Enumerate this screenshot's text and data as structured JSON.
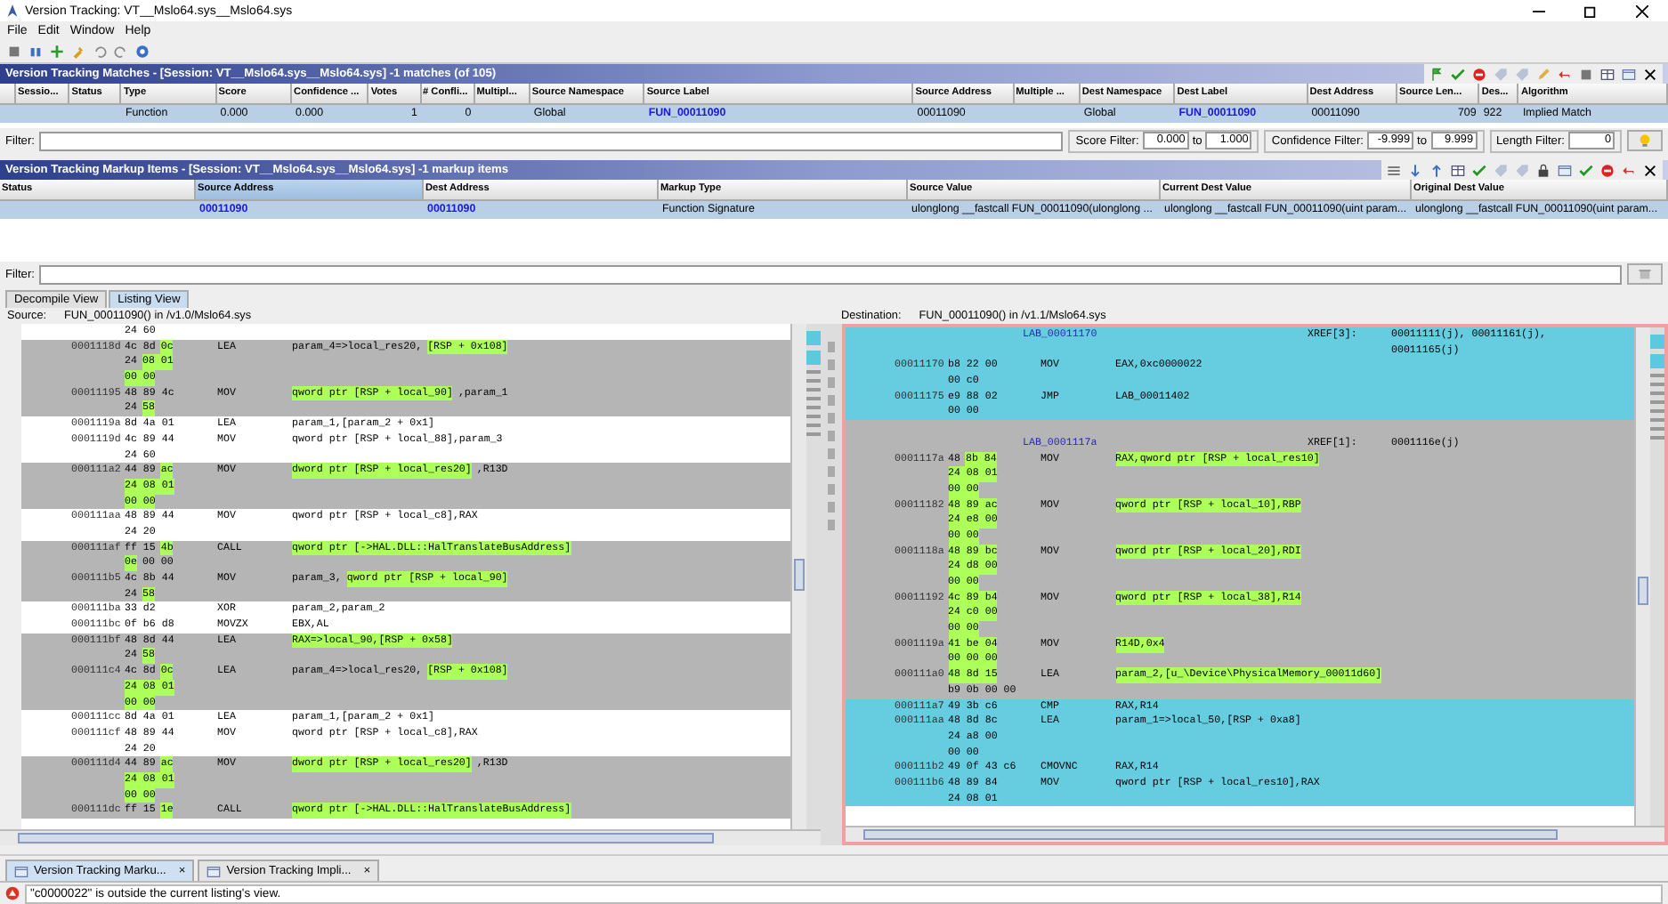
{
  "window": {
    "title": "Version Tracking: VT__Mslo64.sys__Mslo64.sys"
  },
  "menu": [
    "File",
    "Edit",
    "Window",
    "Help"
  ],
  "matches": {
    "title": "Version Tracking Matches - [Session: VT__Mslo64.sys__Mslo64.sys] -1 matches (of 105)",
    "columns": [
      {
        "label": "Sessio...",
        "kind": "text"
      },
      {
        "label": "Status",
        "kind": "text"
      },
      {
        "label": "Type",
        "kind": "text"
      },
      {
        "label": "Score",
        "kind": "text"
      },
      {
        "label": "Confidence ...",
        "kind": "text"
      },
      {
        "label": "Votes",
        "kind": "number"
      },
      {
        "label": "# Confli...",
        "kind": "number"
      },
      {
        "label": "Multipl...",
        "kind": "text"
      },
      {
        "label": "Source Namespace",
        "kind": "text"
      },
      {
        "label": "Source Label",
        "kind": "link"
      },
      {
        "label": "Source Address",
        "kind": "text"
      },
      {
        "label": "Multiple ...",
        "kind": "text"
      },
      {
        "label": "Dest Namespace",
        "kind": "text"
      },
      {
        "label": "Dest Label",
        "kind": "link"
      },
      {
        "label": "Dest Address",
        "kind": "text"
      },
      {
        "label": "Source Len...",
        "kind": "number"
      },
      {
        "label": "Des...",
        "kind": "text"
      },
      {
        "label": "Algorithm",
        "kind": "text"
      }
    ],
    "rows": [
      {
        "selected": true,
        "cells": [
          "",
          "",
          "Function",
          "0.000",
          "0.000",
          "1",
          "0",
          "",
          "Global",
          "FUN_00011090",
          "00011090",
          "",
          "Global",
          "FUN_00011090",
          "00011090",
          "709",
          "922",
          "Implied Match"
        ]
      }
    ],
    "filter_label": "Filter:",
    "score_filter": {
      "label": "Score Filter:",
      "from": "0.000",
      "to_label": "to",
      "to": "1.000"
    },
    "confidence_filter": {
      "label": "Confidence Filter:",
      "from": "-9.999",
      "to_label": "to",
      "to": "9.999"
    },
    "length_filter": {
      "label": "Length Filter:",
      "value": "0"
    }
  },
  "markup": {
    "title": "Version Tracking Markup Items - [Session: VT__Mslo64.sys__Mslo64.sys] -1 markup items",
    "columns": [
      {
        "label": "Status",
        "kind": "text",
        "sorted": false
      },
      {
        "label": "Source Address",
        "kind": "link",
        "sorted": true
      },
      {
        "label": "Dest Address",
        "kind": "link",
        "sorted": false
      },
      {
        "label": "Markup Type",
        "kind": "text",
        "sorted": false
      },
      {
        "label": "Source Value",
        "kind": "text",
        "sorted": false
      },
      {
        "label": "Current Dest Value",
        "kind": "text",
        "sorted": false
      },
      {
        "label": "Original Dest Value",
        "kind": "text",
        "sorted": false
      }
    ],
    "rows": [
      {
        "selected": true,
        "cells": [
          "",
          "00011090",
          "00011090",
          "Function Signature",
          "ulonglong __fastcall FUN_00011090(ulonglong ...",
          "ulonglong __fastcall FUN_00011090(uint param...",
          "ulonglong __fastcall FUN_00011090(uint param..."
        ]
      }
    ],
    "filter_label": "Filter:"
  },
  "view_tabs": [
    {
      "label": "Decompile View",
      "selected": false
    },
    {
      "label": "Listing View",
      "selected": true
    }
  ],
  "source": {
    "label": "Source:",
    "function": "FUN_00011090() in /v1.0/Mslo64.sys",
    "blocks": [
      {
        "kind": "plain",
        "lines": [
          {
            "kind": "more",
            "bytes": [
              {
                "text": "24 60",
                "marked": false
              }
            ]
          }
        ]
      },
      {
        "kind": "markup",
        "lines": [
          {
            "kind": "code",
            "address": "0001118d",
            "bytes": [
              {
                "text": "4c 8d",
                "marked": false
              },
              {
                "text": "0c",
                "marked": true
              }
            ],
            "mnemonic": "LEA",
            "operand": [
              {
                "text": "param_4=>local_res20,",
                "marked": false
              },
              {
                "text": "[RSP + 0x108]",
                "marked": true
              }
            ]
          },
          {
            "kind": "more",
            "bytes": [
              {
                "text": "24",
                "marked": false
              },
              {
                "text": "08 01",
                "marked": true
              }
            ]
          },
          {
            "kind": "more",
            "bytes": [
              {
                "text": "00 00",
                "marked": true
              }
            ]
          },
          {
            "kind": "code",
            "address": "00011195",
            "bytes": [
              {
                "text": "48 89 4c",
                "marked": false
              }
            ],
            "mnemonic": "MOV",
            "operand": [
              {
                "text": "qword ptr [RSP + local_90]",
                "marked": true
              },
              {
                "text": ",param_1",
                "marked": false
              }
            ]
          },
          {
            "kind": "more",
            "bytes": [
              {
                "text": "24",
                "marked": false
              },
              {
                "text": "58",
                "marked": true
              }
            ]
          }
        ]
      },
      {
        "kind": "plain",
        "lines": [
          {
            "kind": "code",
            "address": "0001119a",
            "bytes": [
              {
                "text": "8d 4a 01",
                "marked": false
              }
            ],
            "mnemonic": "LEA",
            "operand": [
              {
                "text": "param_1,[param_2 + 0x1]",
                "marked": false
              }
            ]
          },
          {
            "kind": "code",
            "address": "0001119d",
            "bytes": [
              {
                "text": "4c 89 44",
                "marked": false
              }
            ],
            "mnemonic": "MOV",
            "operand": [
              {
                "text": "qword ptr [RSP + local_88],param_3",
                "marked": false
              }
            ]
          },
          {
            "kind": "more",
            "bytes": [
              {
                "text": "24 60",
                "marked": false
              }
            ]
          }
        ]
      },
      {
        "kind": "markup",
        "lines": [
          {
            "kind": "code",
            "address": "000111a2",
            "bytes": [
              {
                "text": "44 89",
                "marked": false
              },
              {
                "text": "ac",
                "marked": true
              }
            ],
            "mnemonic": "MOV",
            "operand": [
              {
                "text": "dword ptr [RSP + local_res20]",
                "marked": true
              },
              {
                "text": ",R13D",
                "marked": false
              }
            ]
          },
          {
            "kind": "more",
            "bytes": [
              {
                "text": "24 08 01",
                "marked": true
              }
            ]
          },
          {
            "kind": "more",
            "bytes": [
              {
                "text": "00 00",
                "marked": true
              }
            ]
          }
        ]
      },
      {
        "kind": "plain",
        "lines": [
          {
            "kind": "code",
            "address": "000111aa",
            "bytes": [
              {
                "text": "48 89 44",
                "marked": false
              }
            ],
            "mnemonic": "MOV",
            "operand": [
              {
                "text": "qword ptr [RSP + local_c8],RAX",
                "marked": false
              }
            ]
          },
          {
            "kind": "more",
            "bytes": [
              {
                "text": "24 20",
                "marked": false
              }
            ]
          }
        ]
      },
      {
        "kind": "markup",
        "lines": [
          {
            "kind": "code",
            "address": "000111af",
            "bytes": [
              {
                "text": "ff 15",
                "marked": false
              },
              {
                "text": "4b",
                "marked": true
              }
            ],
            "mnemonic": "CALL",
            "operand": [
              {
                "text": "qword ptr [->HAL.DLL::HalTranslateBusAddress]",
                "marked": true
              }
            ]
          },
          {
            "kind": "more",
            "bytes": [
              {
                "text": "0e",
                "marked": true
              },
              {
                "text": "00 00",
                "marked": false
              }
            ]
          },
          {
            "kind": "code",
            "address": "000111b5",
            "bytes": [
              {
                "text": "4c 8b 44",
                "marked": false
              }
            ],
            "mnemonic": "MOV",
            "operand": [
              {
                "text": "param_3,",
                "marked": false
              },
              {
                "text": "qword ptr [RSP + local_90]",
                "marked": true
              }
            ]
          },
          {
            "kind": "more",
            "bytes": [
              {
                "text": "24",
                "marked": false
              },
              {
                "text": "58",
                "marked": true
              }
            ]
          }
        ]
      },
      {
        "kind": "plain",
        "lines": [
          {
            "kind": "code",
            "address": "000111ba",
            "bytes": [
              {
                "text": "33 d2",
                "marked": false
              }
            ],
            "mnemonic": "XOR",
            "operand": [
              {
                "text": "param_2,param_2",
                "marked": false
              }
            ]
          },
          {
            "kind": "code",
            "address": "000111bc",
            "bytes": [
              {
                "text": "0f b6 d8",
                "marked": false
              }
            ],
            "mnemonic": "MOVZX",
            "operand": [
              {
                "text": "EBX,AL",
                "marked": false
              }
            ]
          }
        ]
      },
      {
        "kind": "markup",
        "lines": [
          {
            "kind": "code",
            "address": "000111bf",
            "bytes": [
              {
                "text": "48 8d 44",
                "marked": false
              }
            ],
            "mnemonic": "LEA",
            "operand": [
              {
                "text": "RAX=>local_90,[RSP + 0x58]",
                "marked": true
              }
            ]
          },
          {
            "kind": "more",
            "bytes": [
              {
                "text": "24",
                "marked": false
              },
              {
                "text": "58",
                "marked": true
              }
            ]
          },
          {
            "kind": "code",
            "address": "000111c4",
            "bytes": [
              {
                "text": "4c 8d",
                "marked": false
              },
              {
                "text": "0c",
                "marked": true
              }
            ],
            "mnemonic": "LEA",
            "operand": [
              {
                "text": "param_4=>local_res20,",
                "marked": false
              },
              {
                "text": "[RSP + 0x108]",
                "marked": true
              }
            ]
          },
          {
            "kind": "more",
            "bytes": [
              {
                "text": "24 08 01",
                "marked": true
              }
            ]
          },
          {
            "kind": "more",
            "bytes": [
              {
                "text": "00 00",
                "marked": true
              }
            ]
          }
        ]
      },
      {
        "kind": "plain",
        "lines": [
          {
            "kind": "code",
            "address": "000111cc",
            "bytes": [
              {
                "text": "8d 4a 01",
                "marked": false
              }
            ],
            "mnemonic": "LEA",
            "operand": [
              {
                "text": "param_1,[param_2 + 0x1]",
                "marked": false
              }
            ]
          },
          {
            "kind": "code",
            "address": "000111cf",
            "bytes": [
              {
                "text": "48 89 44",
                "marked": false
              }
            ],
            "mnemonic": "MOV",
            "operand": [
              {
                "text": "qword ptr [RSP + local_c8],RAX",
                "marked": false
              }
            ]
          },
          {
            "kind": "more",
            "bytes": [
              {
                "text": "24 20",
                "marked": false
              }
            ]
          }
        ]
      },
      {
        "kind": "markup",
        "lines": [
          {
            "kind": "code",
            "address": "000111d4",
            "bytes": [
              {
                "text": "44 89",
                "marked": false
              },
              {
                "text": "ac",
                "marked": true
              }
            ],
            "mnemonic": "MOV",
            "operand": [
              {
                "text": "dword ptr [RSP + local_res20]",
                "marked": true
              },
              {
                "text": ",R13D",
                "marked": false
              }
            ]
          },
          {
            "kind": "more",
            "bytes": [
              {
                "text": "24 08 01",
                "marked": true
              }
            ]
          },
          {
            "kind": "more",
            "bytes": [
              {
                "text": "00 00",
                "marked": true
              }
            ]
          },
          {
            "kind": "code",
            "address": "000111dc",
            "bytes": [
              {
                "text": "ff 15",
                "marked": false
              },
              {
                "text": "1e",
                "marked": true
              }
            ],
            "mnemonic": "CALL",
            "operand": [
              {
                "text": "qword ptr [->HAL.DLL::HalTranslateBusAddress]",
                "marked": true
              }
            ]
          }
        ]
      }
    ]
  },
  "destination": {
    "label": "Destination:",
    "function": "FUN_00011090() in /v1.1/Mslo64.sys",
    "blocks": [
      {
        "kind": "cursor",
        "lines": [
          {
            "kind": "label",
            "label": "LAB_00011170",
            "xref_title": "XREF[3]:",
            "xrefs": [
              "00011111(j), 00011161(j),",
              "00011165(j)"
            ]
          },
          {
            "kind": "code",
            "address": "00011170",
            "bytes": [
              {
                "text": "b8 22 00",
                "marked": false
              }
            ],
            "mnemonic": "MOV",
            "operand": [
              {
                "text": "EAX,0xc0000022",
                "marked": false
              }
            ]
          },
          {
            "kind": "more",
            "bytes": [
              {
                "text": "00 c0",
                "marked": false
              }
            ]
          },
          {
            "kind": "code",
            "address": "00011175",
            "bytes": [
              {
                "text": "e9 88 02",
                "marked": false
              }
            ],
            "mnemonic": "JMP",
            "operand": [
              {
                "text": "LAB_00011402",
                "marked": false
              }
            ]
          },
          {
            "kind": "more",
            "bytes": [
              {
                "text": "00 00",
                "marked": false
              }
            ]
          }
        ]
      },
      {
        "kind": "markup",
        "lines": [
          {
            "kind": "label",
            "label": "LAB_0001117a",
            "xref_title": "XREF[1]:",
            "xrefs": [
              "0001116e(j)"
            ]
          },
          {
            "kind": "code",
            "address": "0001117a",
            "bytes": [
              {
                "text": "48",
                "marked": false
              },
              {
                "text": "8b 84",
                "marked": true
              }
            ],
            "mnemonic": "MOV",
            "operand": [
              {
                "text": "RAX,qword ptr [RSP + local_res10]",
                "marked": true
              }
            ]
          },
          {
            "kind": "more",
            "bytes": [
              {
                "text": "24 08 01",
                "marked": true
              }
            ]
          },
          {
            "kind": "more",
            "bytes": [
              {
                "text": "00 00",
                "marked": true
              }
            ]
          },
          {
            "kind": "code",
            "address": "00011182",
            "bytes": [
              {
                "text": "48 89 ac",
                "marked": true
              }
            ],
            "mnemonic": "MOV",
            "operand": [
              {
                "text": "qword ptr [RSP + local_10],RBP",
                "marked": true
              }
            ]
          },
          {
            "kind": "more",
            "bytes": [
              {
                "text": "24 e8 00",
                "marked": true
              }
            ]
          },
          {
            "kind": "more",
            "bytes": [
              {
                "text": "00 00",
                "marked": true
              }
            ]
          },
          {
            "kind": "code",
            "address": "0001118a",
            "bytes": [
              {
                "text": "48 89 bc",
                "marked": true
              }
            ],
            "mnemonic": "MOV",
            "operand": [
              {
                "text": "qword ptr [RSP + local_20],RDI",
                "marked": true
              }
            ]
          },
          {
            "kind": "more",
            "bytes": [
              {
                "text": "24 d8 00",
                "marked": true
              }
            ]
          },
          {
            "kind": "more",
            "bytes": [
              {
                "text": "00 00",
                "marked": true
              }
            ]
          },
          {
            "kind": "code",
            "address": "00011192",
            "bytes": [
              {
                "text": "4c 89 b4",
                "marked": true
              }
            ],
            "mnemonic": "MOV",
            "operand": [
              {
                "text": "qword ptr [RSP + local_38],R14",
                "marked": true
              }
            ]
          },
          {
            "kind": "more",
            "bytes": [
              {
                "text": "24 c0 00",
                "marked": true
              }
            ]
          },
          {
            "kind": "more",
            "bytes": [
              {
                "text": "00 00",
                "marked": true
              }
            ]
          },
          {
            "kind": "code",
            "address": "0001119a",
            "bytes": [
              {
                "text": "41 be 04",
                "marked": true
              }
            ],
            "mnemonic": "MOV",
            "operand": [
              {
                "text": "R14D,0x4",
                "marked": true
              }
            ]
          },
          {
            "kind": "more",
            "bytes": [
              {
                "text": "00 00 00",
                "marked": true
              }
            ]
          },
          {
            "kind": "code",
            "address": "000111a0",
            "bytes": [
              {
                "text": "48 8d 15",
                "marked": true
              }
            ],
            "mnemonic": "LEA",
            "operand": [
              {
                "text": "param_2,[u_\\Device\\PhysicalMemory_00011d60]",
                "marked": true
              }
            ]
          },
          {
            "kind": "more",
            "bytes": [
              {
                "text": "b9 0b 00 00",
                "marked": false
              }
            ]
          }
        ]
      },
      {
        "kind": "cursor",
        "lines": [
          {
            "kind": "code",
            "address": "000111a7",
            "bytes": [
              {
                "text": "49 3b c6",
                "marked": false
              }
            ],
            "mnemonic": "CMP",
            "operand": [
              {
                "text": "RAX,R14",
                "marked": false
              }
            ]
          },
          {
            "kind": "code",
            "address": "000111aa",
            "bytes": [
              {
                "text": "48 8d 8c",
                "marked": false
              }
            ],
            "mnemonic": "LEA",
            "operand": [
              {
                "text": "param_1=>local_50,[RSP + 0xa8]",
                "marked": false
              }
            ]
          },
          {
            "kind": "more",
            "bytes": [
              {
                "text": "24 a8 00",
                "marked": false
              }
            ]
          },
          {
            "kind": "more",
            "bytes": [
              {
                "text": "00 00",
                "marked": false
              }
            ]
          },
          {
            "kind": "code",
            "address": "000111b2",
            "bytes": [
              {
                "text": "49 0f 43 c6",
                "marked": false
              }
            ],
            "mnemonic": "CMOVNC",
            "operand": [
              {
                "text": "RAX,R14",
                "marked": false
              }
            ]
          },
          {
            "kind": "code",
            "address": "000111b6",
            "bytes": [
              {
                "text": "48 89 84",
                "marked": false
              }
            ],
            "mnemonic": "MOV",
            "operand": [
              {
                "text": "qword ptr [RSP + local_res10],RAX",
                "marked": false
              }
            ]
          },
          {
            "kind": "more",
            "bytes": [
              {
                "text": "24 08 01",
                "marked": false
              }
            ]
          }
        ]
      }
    ]
  },
  "bottom_tabs": [
    {
      "label": "Version Tracking Marku...",
      "close": "×",
      "selected": true
    },
    {
      "label": "Version Tracking Impli...",
      "close": "×",
      "selected": false
    }
  ],
  "status_bar": {
    "message": "\"c0000022\" is outside the current listing's view."
  }
}
